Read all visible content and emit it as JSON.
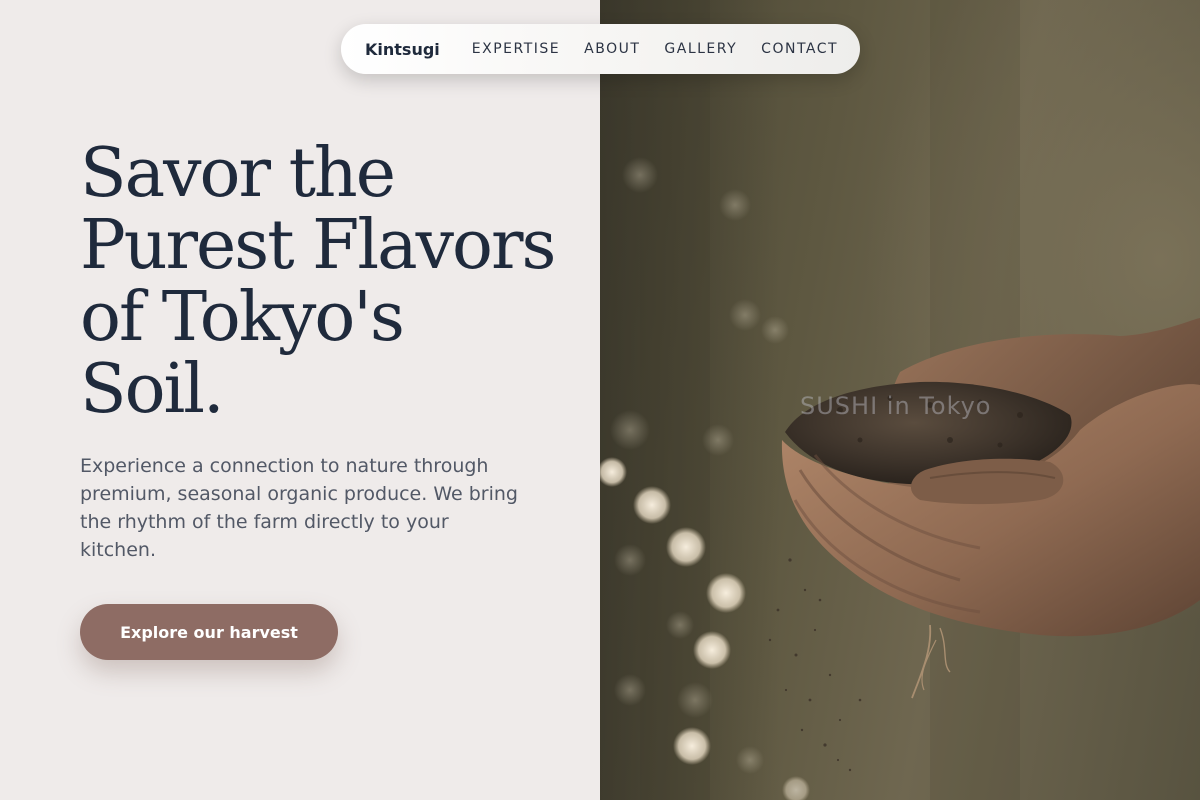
{
  "nav": {
    "brand": "Kintsugi",
    "links": [
      "EXPERTISE",
      "ABOUT",
      "GALLERY",
      "CONTACT"
    ]
  },
  "hero": {
    "title_lines": [
      "Savor the",
      "Purest Flavors",
      "of Tokyo's",
      "Soil."
    ],
    "description": "Experience a connection to nature through premium, seasonal organic produce. We bring the rhythm of the farm directly to your kitchen.",
    "cta_label": "Explore our harvest"
  },
  "image": {
    "watermark_text": "SUSHI in Tokyo"
  },
  "colors": {
    "background": "#efebea",
    "heading": "#1f2a3c",
    "body_text": "#525866",
    "accent": "#8e6c64"
  }
}
